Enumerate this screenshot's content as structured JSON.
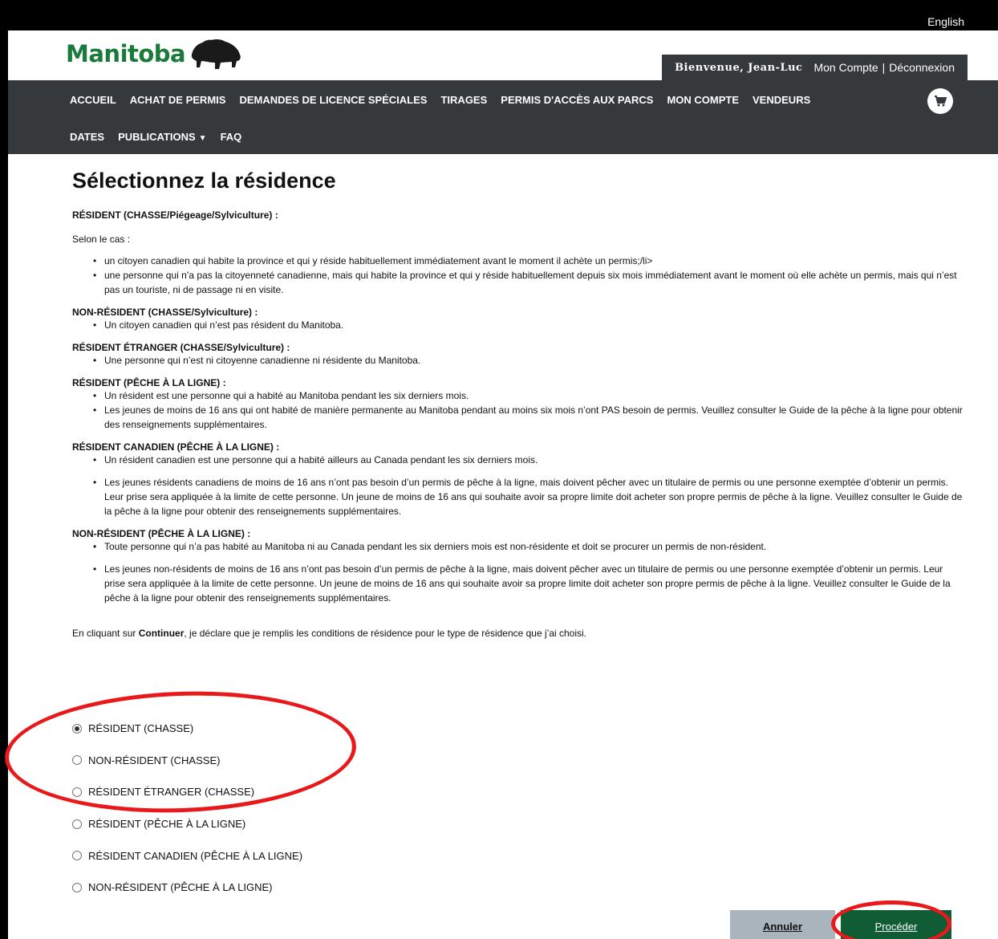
{
  "lang_link": "English",
  "header": {
    "logo_text": "Manitoba",
    "welcome": "Bienvenue, Jean-Luc",
    "account_link": "Mon Compte",
    "separator": "|",
    "logout_link": "Déconnexion"
  },
  "nav": {
    "row1": [
      "ACCUEIL",
      "ACHAT DE PERMIS",
      "DEMANDES DE LICENCE SPÉCIALES",
      "TIRAGES",
      "PERMIS D'ACCÈS AUX PARCS",
      "MON COMPTE",
      "VENDEURS"
    ],
    "row2": [
      "DATES",
      "PUBLICATIONS",
      "FAQ"
    ],
    "cart_icon": "cart-icon"
  },
  "page_title": "Sélectionnez la résidence",
  "sections": {
    "s1": {
      "title": "RÉSIDENT (CHASSE/Piégeage/Sylviculture) :",
      "intro": "Selon le cas :",
      "items": [
        "un citoyen canadien qui habite la province et qui y réside habituellement immédiatement avant le moment il achète un permis;/li>",
        "une personne qui n’a pas la citoyenneté canadienne, mais qui habite la province et qui y réside habituellement depuis six mois immédiatement avant le moment où elle achète un permis, mais qui n’est pas un touriste, ni de passage ni en visite."
      ]
    },
    "s2": {
      "title": "NON-RÉSIDENT (CHASSE/Sylviculture) :",
      "items": [
        "Un citoyen canadien qui n’est pas résident du Manitoba."
      ]
    },
    "s3": {
      "title": "RÉSIDENT ÉTRANGER (CHASSE/Sylviculture) :",
      "items": [
        "Une personne qui n’est ni citoyenne canadienne ni résidente du Manitoba."
      ]
    },
    "s4": {
      "title": "RÉSIDENT (PÊCHE À LA LIGNE) :",
      "items": [
        "Un résident est une personne qui a habité au Manitoba pendant les six derniers mois.",
        "Les jeunes de moins de 16 ans qui ont habité de manière permanente au Manitoba pendant au moins six mois n’ont PAS besoin de permis. Veuillez consulter le Guide de la pêche à la ligne pour obtenir des renseignements supplémentaires."
      ]
    },
    "s5": {
      "title": "RÉSIDENT CANADIEN (PÊCHE À LA LIGNE) :",
      "items": [
        "Un résident canadien est une personne qui a habité ailleurs au Canada pendant les six derniers mois.",
        "Les jeunes résidents canadiens de moins de 16 ans n’ont pas besoin d’un permis de pêche à la ligne, mais doivent pêcher avec un titulaire de permis ou une personne exemptée d’obtenir un permis. Leur prise sera appliquée à la limite de cette personne. Un jeune de moins de 16 ans qui souhaite avoir sa propre limite doit acheter son propre permis de pêche à la ligne. Veuillez consulter le Guide de la pêche à la ligne pour obtenir des renseignements supplémentaires."
      ]
    },
    "s6": {
      "title": "NON-RÉSIDENT (PÊCHE À LA LIGNE) :",
      "items": [
        "Toute personne qui n’a pas habité au Manitoba ni au Canada pendant les six derniers mois est non-résidente et doit se procurer un permis de non-résident.",
        "Les jeunes non-résidents de moins de 16 ans n’ont pas besoin d’un permis de pêche à la ligne, mais doivent pêcher avec un titulaire de permis ou une personne exemptée d’obtenir un permis. Leur prise sera appliquée à la limite de cette personne. Un jeune de moins de 16 ans qui souhaite avoir sa propre limite doit acheter son propre permis de pêche à la ligne. Veuillez consulter le Guide de la pêche à la ligne pour obtenir des renseignements supplémentaires."
      ]
    }
  },
  "declaration": {
    "before": "En cliquant sur ",
    "bold": "Continuer",
    "after": ", je déclare que je remplis les conditions de résidence pour le type de résidence que j’ai choisi."
  },
  "residency_options": [
    "RÉSIDENT (CHASSE)",
    "NON-RÉSIDENT (CHASSE)",
    "RÉSIDENT ÉTRANGER (CHASSE)",
    "RÉSIDENT (PÊCHE À LA LIGNE)",
    "RÉSIDENT CANADIEN (PÊCHE À LA LIGNE)",
    "NON-RÉSIDENT (PÊCHE À LA LIGNE)"
  ],
  "selected_option": "RÉSIDENT (CHASSE)",
  "buttons": {
    "cancel": "Annuler",
    "proceed": "Procéder"
  },
  "colors": {
    "nav_bg": "#35393b",
    "brand_green": "#1a7a3c",
    "proceed_bg": "#0f5c35",
    "cancel_bg": "#a9b4bd",
    "annotation": "#e8181b"
  }
}
